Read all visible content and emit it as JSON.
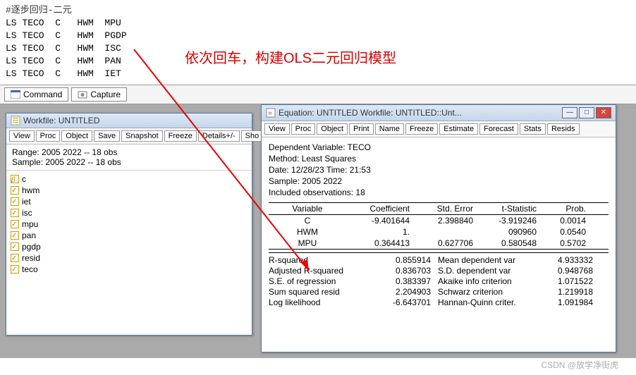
{
  "code": {
    "comment": "#逐步回归-二元",
    "lines": [
      "LS TECO  C   HWM  MPU",
      "LS TECO  C   HWM  PGDP",
      "LS TECO  C   HWM  ISC",
      "LS TECO  C   HWM  PAN",
      "LS TECO  C   HWM  IET"
    ]
  },
  "annotation": "依次回车，构建OLS二元回归模型",
  "cmdbar": {
    "command": "Command",
    "capture": "Capture"
  },
  "workfile": {
    "title": "Workfile: UNTITLED",
    "toolbar": [
      "View",
      "Proc",
      "Object",
      "Save",
      "Snapshot",
      "Freeze",
      "Details+/-",
      "Sho"
    ],
    "range": "Range:  2005 2022   --   18 obs",
    "sample": "Sample: 2005 2022   --   18 obs",
    "vars": [
      "c",
      "hwm",
      "iet",
      "isc",
      "mpu",
      "pan",
      "pgdp",
      "resid",
      "teco"
    ]
  },
  "equation": {
    "title": "Equation: UNTITLED   Workfile: UNTITLED::Unt...",
    "toolbar": [
      "View",
      "Proc",
      "Object",
      "Print",
      "Name",
      "Freeze",
      "Estimate",
      "Forecast",
      "Stats",
      "Resids"
    ],
    "meta": {
      "dep": "Dependent Variable: TECO",
      "method": "Method: Least Squares",
      "date": "Date: 12/28/23   Time: 21:53",
      "sample": "Sample: 2005 2022",
      "obs": "Included observations: 18"
    },
    "headers": {
      "v": "Variable",
      "c": "Coefficient",
      "s": "Std. Error",
      "t": "t-Statistic",
      "p": "Prob."
    },
    "rows": [
      {
        "v": "C",
        "c": "-9.401644",
        "s": "2.398840",
        "t": "-3.919246",
        "p": "0.0014"
      },
      {
        "v": "HWM",
        "c": "1.",
        "s": "",
        "t": "090960",
        "p": "0.0540"
      },
      {
        "v": "MPU",
        "c": "0.364413",
        "s": "0.627706",
        "t": "0.580548",
        "p": "0.5702"
      }
    ],
    "stats": [
      {
        "l1": "R-squared",
        "v1": "0.855914",
        "l2": "Mean dependent var",
        "v2": "4.933332"
      },
      {
        "l1": "Adjusted R-squared",
        "v1": "0.836703",
        "l2": "S.D. dependent var",
        "v2": "0.948768"
      },
      {
        "l1": "S.E. of regression",
        "v1": "0.383397",
        "l2": "Akaike info criterion",
        "v2": "1.071522"
      },
      {
        "l1": "Sum squared resid",
        "v1": "2.204903",
        "l2": "Schwarz criterion",
        "v2": "1.219918"
      },
      {
        "l1": "Log likelihood",
        "v1": "-6.643701",
        "l2": "Hannan-Quinn criter.",
        "v2": "1.091984"
      }
    ]
  },
  "watermark": "CSDN @放学净街虎"
}
